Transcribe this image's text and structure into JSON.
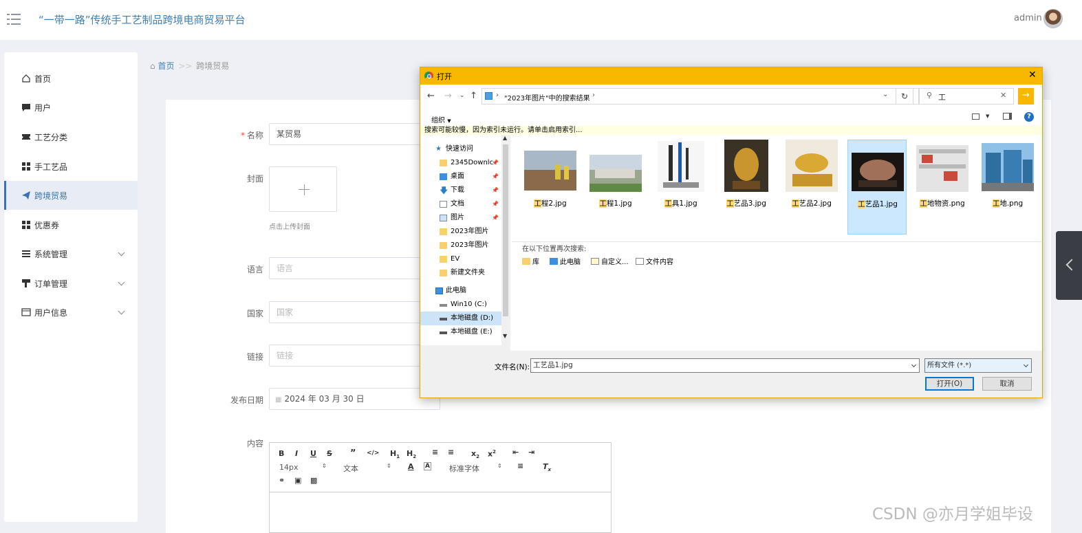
{
  "app": {
    "title": "“一带一路”传统手工艺制品跨境电商贸易平台",
    "user": "admin"
  },
  "sidebar": {
    "items": [
      {
        "label": "首页",
        "icon": "home-icon"
      },
      {
        "label": "用户",
        "icon": "chat-icon"
      },
      {
        "label": "工艺分类",
        "icon": "ticket-icon"
      },
      {
        "label": "手工艺品",
        "icon": "grid-icon"
      },
      {
        "label": "跨境贸易",
        "icon": "paper-plane-icon",
        "active": true
      },
      {
        "label": "优惠券",
        "icon": "grid-icon"
      },
      {
        "label": "系统管理",
        "icon": "list-icon",
        "expandable": true
      },
      {
        "label": "订单管理",
        "icon": "hammer-icon",
        "expandable": true
      },
      {
        "label": "用户信息",
        "icon": "card-icon",
        "expandable": true
      }
    ]
  },
  "breadcrumb": {
    "home": "首页",
    "sep": ">>",
    "current": "跨境贸易"
  },
  "form": {
    "name_label": "名称",
    "name_value": "某贸易",
    "cover_label": "封面",
    "cover_hint": "点击上传封面",
    "language_label": "语言",
    "language_placeholder": "语言",
    "country_label": "国家",
    "country_placeholder": "国家",
    "link_label": "链接",
    "link_placeholder": "链接",
    "date_label": "发布日期",
    "date_value": "2024 年 03 月 30 日",
    "content_label": "内容"
  },
  "editor": {
    "font_size": "14px",
    "text_type": "文本",
    "font_family": "标准字体"
  },
  "dialog": {
    "title": "打开",
    "path": "\"2023年图片\"中的搜索结果",
    "search_query": "工",
    "organize": "组织",
    "info_bar": "搜索可能较慢，因为索引未运行。请单击启用索引...",
    "tree": [
      {
        "label": "快速访问",
        "indent": 0,
        "icon": "star-icon"
      },
      {
        "label": "2345Downlc",
        "indent": 1,
        "icon": "folder-icon",
        "pinned": true
      },
      {
        "label": "桌面",
        "indent": 1,
        "icon": "desktop-icon",
        "pinned": true
      },
      {
        "label": "下载",
        "indent": 1,
        "icon": "download-icon",
        "pinned": true
      },
      {
        "label": "文档",
        "indent": 1,
        "icon": "document-icon",
        "pinned": true
      },
      {
        "label": "图片",
        "indent": 1,
        "icon": "pictures-icon",
        "pinned": true
      },
      {
        "label": "2023年图片",
        "indent": 1,
        "icon": "folder-icon"
      },
      {
        "label": "2023年图片",
        "indent": 1,
        "icon": "folder-icon"
      },
      {
        "label": "EV",
        "indent": 1,
        "icon": "folder-icon"
      },
      {
        "label": "新建文件夹",
        "indent": 1,
        "icon": "folder-icon"
      },
      {
        "label": "此电脑",
        "indent": 0,
        "icon": "computer-icon"
      },
      {
        "label": "Win10 (C:)",
        "indent": 1,
        "icon": "drive-icon"
      },
      {
        "label": "本地磁盘 (D:)",
        "indent": 1,
        "icon": "drive-icon",
        "selected": true
      },
      {
        "label": "本地磁盘 (E:)",
        "indent": 1,
        "icon": "drive-icon"
      }
    ],
    "files": [
      {
        "hl": "工",
        "rest": "程2.jpg"
      },
      {
        "hl": "工",
        "rest": "程1.jpg"
      },
      {
        "hl": "工",
        "rest": "具1.jpg"
      },
      {
        "hl": "工",
        "rest": "艺品3.jpg"
      },
      {
        "hl": "工",
        "rest": "艺品2.jpg"
      },
      {
        "hl": "工",
        "rest": "艺品1.jpg",
        "selected": true
      },
      {
        "hl": "工",
        "rest": "地物资.png"
      },
      {
        "hl": "工",
        "rest": "地.png"
      }
    ],
    "search_again": "在以下位置再次搜索:",
    "locations": [
      "库",
      "此电脑",
      "自定义...",
      "文件内容"
    ],
    "filename_label": "文件名(N):",
    "filename_value": "工艺品1.jpg",
    "filter": "所有文件 (*.*)",
    "open_button": "打开(O)",
    "cancel_button": "取消"
  },
  "watermark": "CSDN @亦月学姐毕设",
  "colors": {
    "accent": "#3f7fb5",
    "dialog_title": "#f9b800",
    "required": "#ee4444"
  }
}
